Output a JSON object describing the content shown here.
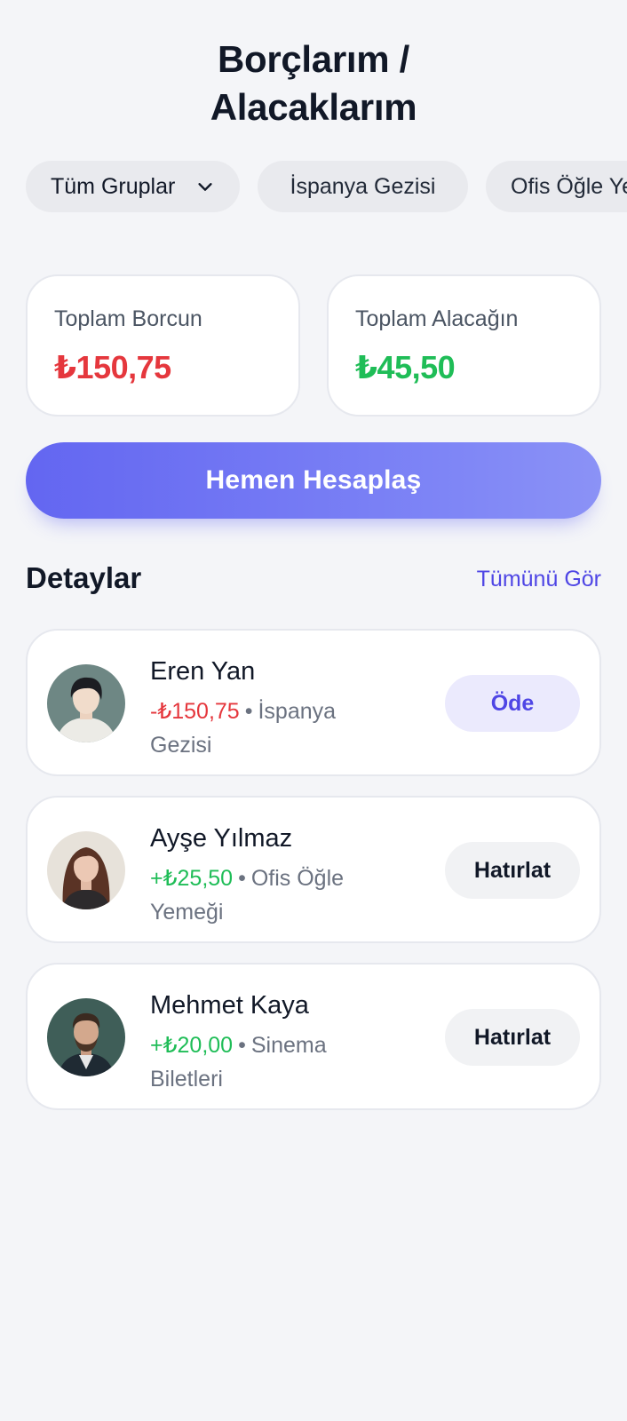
{
  "header": {
    "title_line1": "Borçlarım /",
    "title_line2": "Alacaklarım"
  },
  "filters": {
    "chips": [
      "Tüm Gruplar",
      "İspanya Gezisi",
      "Ofis Öğle Yemeği"
    ],
    "selected_icon": "chevron-down-icon"
  },
  "summary": {
    "debt_label": "Toplam Borcun",
    "debt_value": "₺150,75",
    "credit_label": "Toplam Alacağın",
    "credit_value": "₺45,50"
  },
  "cta": {
    "label": "Hemen Hesaplaş"
  },
  "details": {
    "title": "Detaylar",
    "see_all": "Tümünü Gör",
    "items": [
      {
        "name": "Eren Yan",
        "amount": "-₺150,75",
        "group": "İspanya Gezisi",
        "action": "Öde",
        "avatar": "avatar-icon"
      },
      {
        "name": "Ayşe Yılmaz",
        "amount": "+₺25,50",
        "group": "Ofis Öğle Yemeği",
        "action": "Hatırlat",
        "avatar": "avatar-icon"
      },
      {
        "name": "Mehmet Kaya",
        "amount": "+₺20,00",
        "group": "Sinema Biletleri",
        "action": "Hatırlat",
        "avatar": "avatar-icon"
      }
    ]
  },
  "colors": {
    "accent": "#6366f1",
    "debt": "#e5373d",
    "credit": "#1fbd57",
    "background": "#f4f5f8"
  }
}
